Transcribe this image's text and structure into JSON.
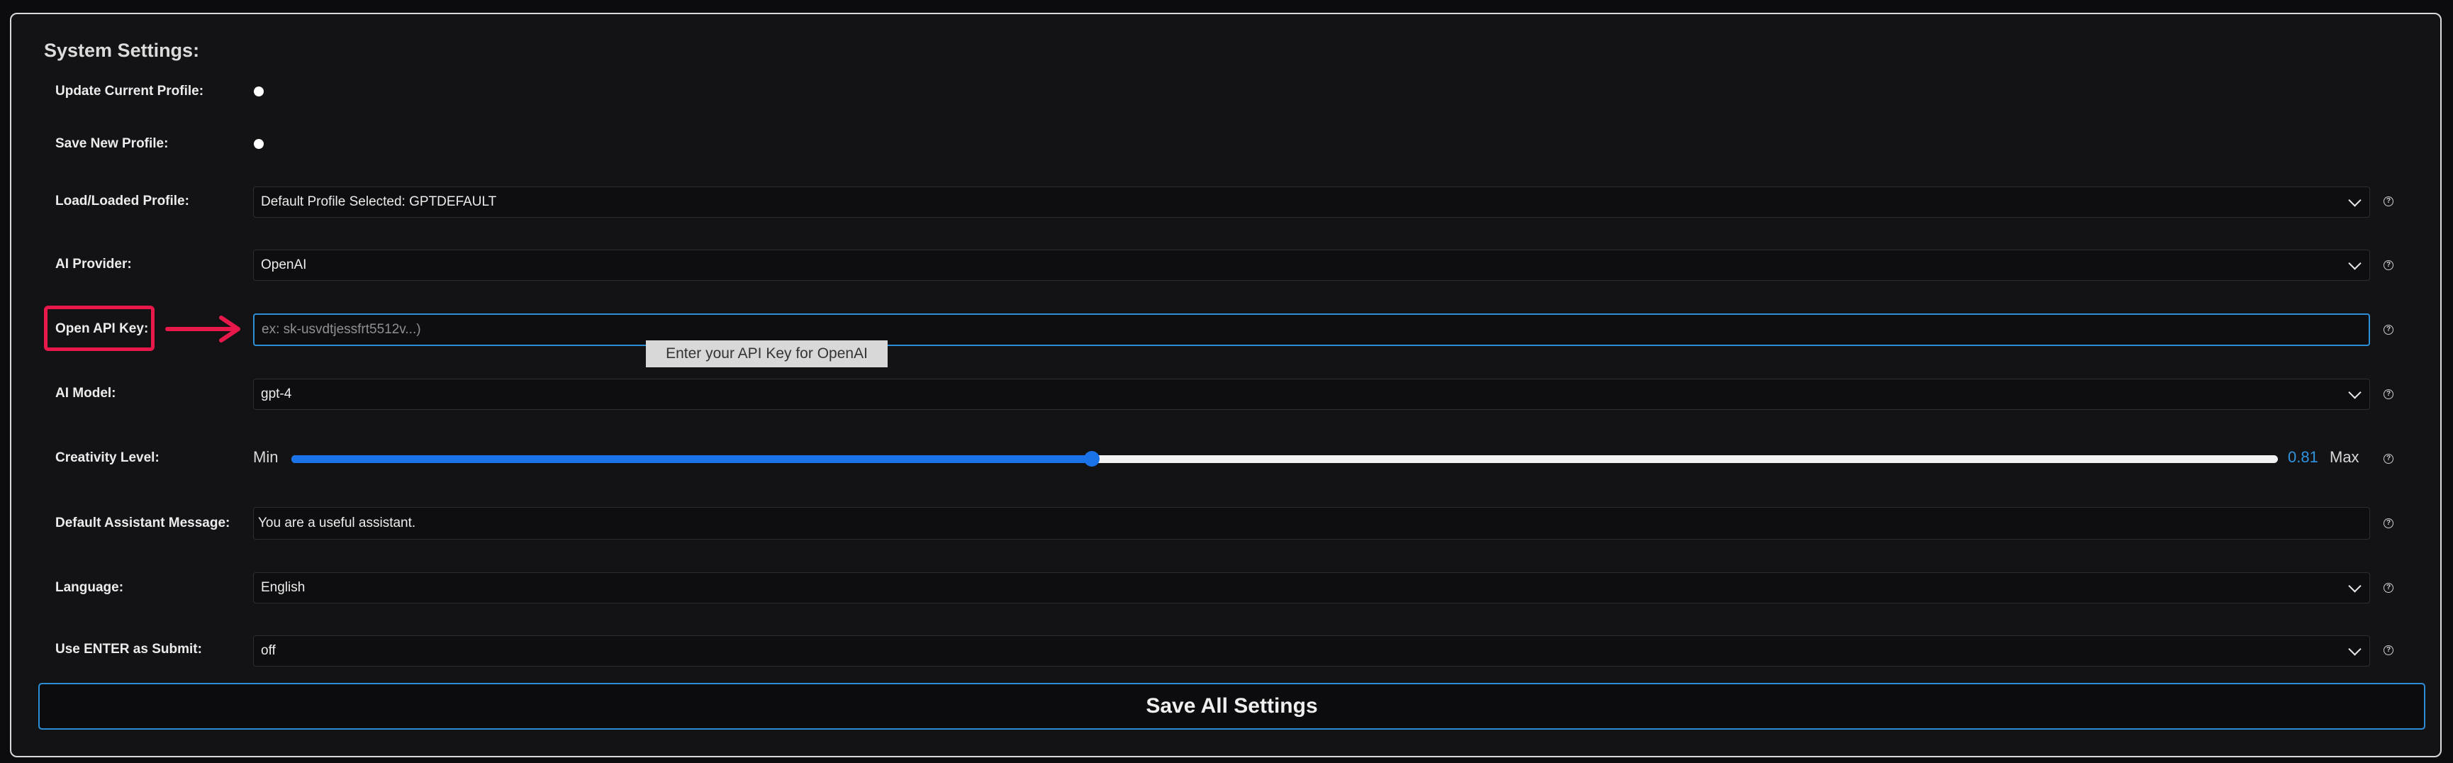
{
  "section_title": "System Settings:",
  "rows": {
    "update_profile": {
      "label": "Update Current Profile:"
    },
    "save_profile": {
      "label": "Save New Profile:"
    },
    "load_profile": {
      "label": "Load/Loaded Profile:",
      "value": "Default Profile Selected: GPTDEFAULT"
    },
    "ai_provider": {
      "label": "AI Provider:",
      "value": "OpenAI"
    },
    "api_key": {
      "label": "Open API Key:",
      "placeholder": "ex: sk-usvdtjessfrt5512v...)",
      "tooltip": "Enter your API Key for OpenAI"
    },
    "ai_model": {
      "label": "AI Model:",
      "value": "gpt-4"
    },
    "creativity": {
      "label": "Creativity Level:",
      "min_label": "Min",
      "max_label": "Max",
      "value": 0.81,
      "value_text": "0.81",
      "fill_fraction": 0.403
    },
    "assistant_message": {
      "label": "Default Assistant Message:",
      "value": "You are a useful assistant."
    },
    "language": {
      "label": "Language:",
      "value": "English"
    },
    "enter_submit": {
      "label": "Use ENTER as Submit:",
      "value": "off"
    }
  },
  "help_glyph": "?",
  "save_button": "Save All Settings",
  "colors": {
    "accent": "#2c8fd6",
    "slider": "#1a73e8",
    "highlight": "#e8194a",
    "background": "#131316"
  },
  "icons": {
    "help": "question-circle-icon",
    "dropdown": "chevron-down-icon",
    "annotation": "arrow-right-icon"
  }
}
